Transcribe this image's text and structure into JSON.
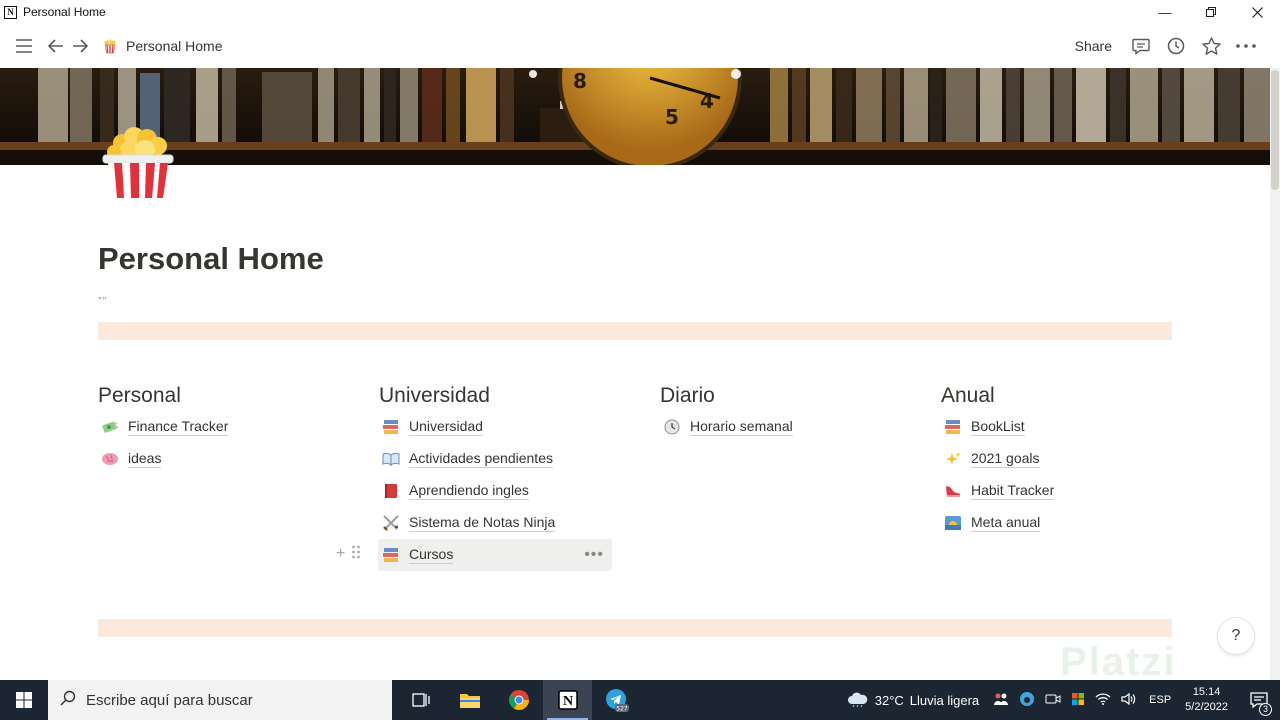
{
  "window": {
    "title": "Personal Home",
    "app_logo": "N"
  },
  "topbar": {
    "breadcrumb": "Personal Home",
    "share_label": "Share"
  },
  "page": {
    "title": "Personal Home",
    "quote": "„„"
  },
  "columns": [
    {
      "heading": "Personal",
      "items": [
        {
          "label": "Finance Tracker",
          "icon": "money-icon"
        },
        {
          "label": "ideas",
          "icon": "brain-icon"
        }
      ]
    },
    {
      "heading": "Universidad",
      "items": [
        {
          "label": "Universidad",
          "icon": "books-icon"
        },
        {
          "label": "Actividades pendientes",
          "icon": "open-book-icon"
        },
        {
          "label": "Aprendiendo ingles",
          "icon": "red-book-icon"
        },
        {
          "label": "Sistema de Notas Ninja",
          "icon": "swords-icon"
        },
        {
          "label": "Cursos",
          "icon": "books-icon"
        }
      ]
    },
    {
      "heading": "Diario",
      "items": [
        {
          "label": "Horario semanal",
          "icon": "clock-icon"
        }
      ]
    },
    {
      "heading": "Anual",
      "items": [
        {
          "label": "BookList",
          "icon": "books-icon"
        },
        {
          "label": "2021 goals",
          "icon": "sparkles-icon"
        },
        {
          "label": "Habit Tracker",
          "icon": "shoe-icon"
        },
        {
          "label": "Meta anual",
          "icon": "sunrise-icon"
        }
      ]
    }
  ],
  "help_label": "?",
  "watermark": "Platzi",
  "taskbar": {
    "search_placeholder": "Escribe aquí para buscar",
    "telegram_badge": "527",
    "weather_temp": "32°C",
    "weather_text": "Lluvia ligera",
    "language": "ESP",
    "time": "15:14",
    "date": "5/2/2022",
    "notification_count": "3"
  }
}
